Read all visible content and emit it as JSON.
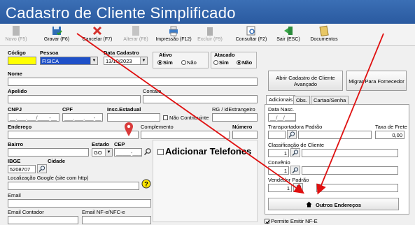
{
  "window_title": "Cadastro de Cliente Simplificado",
  "toolbar": [
    {
      "label": "Novo (F5)",
      "enabled": false,
      "icon": "new-icon"
    },
    {
      "label": "Gravar (F6)",
      "enabled": true,
      "icon": "save-icon"
    },
    {
      "label": "Cancelar (F7)",
      "enabled": true,
      "icon": "cancel-icon"
    },
    {
      "label": "Alterar (F8)",
      "enabled": false,
      "icon": "edit-icon"
    },
    {
      "label": "Impressão (F12)",
      "enabled": true,
      "icon": "printer-icon"
    },
    {
      "label": "Excluir (F9)",
      "enabled": false,
      "icon": "trash-icon"
    },
    {
      "label": "Consultar (F2)",
      "enabled": true,
      "icon": "search-doc-icon"
    },
    {
      "label": "Sair (ESC)",
      "enabled": true,
      "icon": "exit-icon"
    },
    {
      "label": "Documentos",
      "enabled": true,
      "icon": "notepad-icon"
    }
  ],
  "form": {
    "codigo_label": "Código",
    "pessoa_label": "Pessoa",
    "pessoa_value": "FISICA",
    "data_cadastro_label": "Data Cadastro",
    "data_cadastro_value": "13/10/2023",
    "ativo_label": "Ativo",
    "ativo_sim": "Sim",
    "ativo_nao": "Não",
    "atacado_label": "Atacado",
    "atacado_sim": "Sim",
    "atacado_nao": "Não",
    "nome_label": "Nome",
    "apelido_label": "Apelido",
    "contato_label": "Contato",
    "cnpj_label": "CNPJ",
    "cnpj_mask": "__.___.___/____-__",
    "cpf_label": "CPF",
    "cpf_mask": "___.___.___-__",
    "insc_estadual_label": "Insc.Estadual",
    "nao_contribuinte_label": "Não Contribuinte",
    "rg_label": "RG / idEstrangeiro",
    "endereco_label": "Endereço",
    "complemento_label": "Complemento",
    "numero_label": "Número",
    "bairro_label": "Bairro",
    "estado_label": "Estado",
    "estado_value": "GO",
    "cep_label": "CEP",
    "cep_mask": "_____-___",
    "ibge_label": "IBGE",
    "ibge_value": "5208707",
    "cidade_label": "Cidade",
    "localizacao_label": "Localização Google (site com http)",
    "email_label": "Email",
    "email_contador_label": "Email Contador",
    "email_nfe_label": "Email NF-e/NFC-e",
    "adicionar_telefones": "Adicionar Telefones"
  },
  "right_panel": {
    "abrir_cadastro": "Abrir Cadastro de Cliente Avançado",
    "migrar": "Migrar Para Fornecedor",
    "tabs": [
      "Adicionais",
      "Obs.",
      "Cartao/Senha"
    ],
    "data_nasc_label": "Data Nasc.",
    "data_nasc_mask": "__/__/____",
    "transportadora_label": "Transportadora Padrão",
    "taxa_frete_label": "Taxa de Frete",
    "taxa_frete_value": "0,00",
    "classificacao_label": "Classificação de Cliente",
    "classificacao_value": "1",
    "convenio_label": "Convênio",
    "convenio_value": "1",
    "vendedor_label": "Vendedor Padrão",
    "vendedor_value": "1",
    "outros_enderecos": "Outros Endereços",
    "permite_nfe": "Permite Emitir NF-E"
  }
}
